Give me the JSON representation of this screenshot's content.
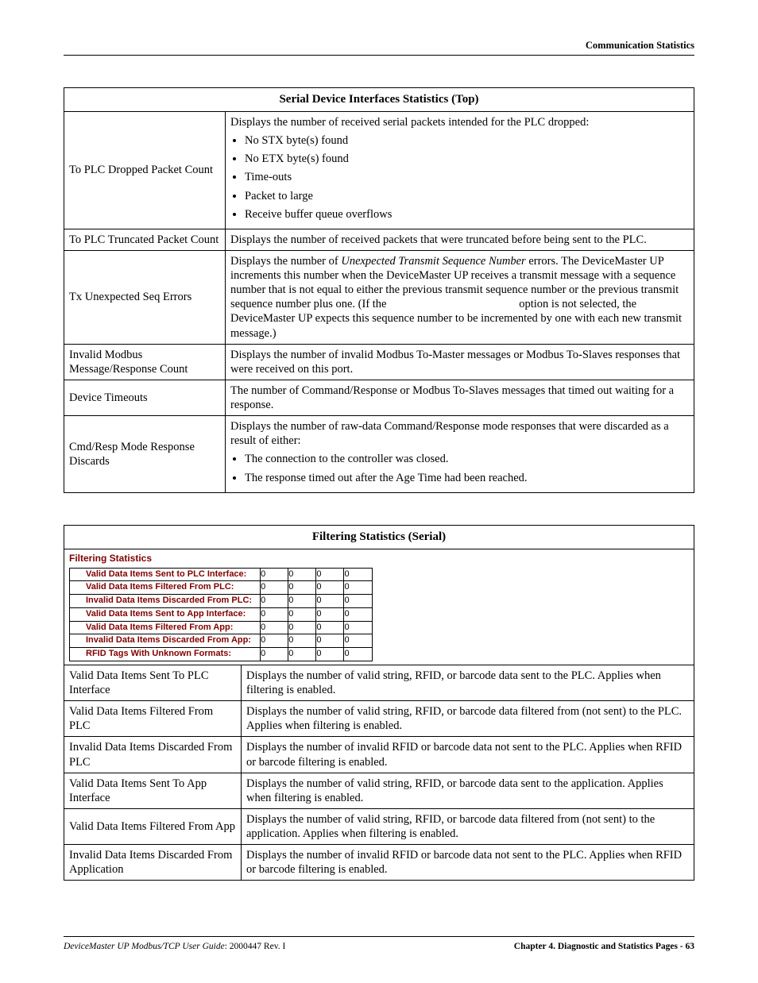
{
  "header": {
    "section": "Communication Statistics"
  },
  "table1": {
    "title": "Serial Device Interfaces Statistics (Top)",
    "rows": {
      "r1": {
        "label": "To PLC Dropped Packet Count",
        "intro": "Displays the number of received serial packets intended for the PLC dropped:",
        "b1": "No STX byte(s) found",
        "b2": "No ETX byte(s) found",
        "b3": "Time-outs",
        "b4": "Packet to large",
        "b5": "Receive buffer queue overflows"
      },
      "r2": {
        "label": "To PLC Truncated Packet Count",
        "desc": "Displays the number of received packets that were truncated before being sent to the PLC."
      },
      "r3": {
        "label": "Tx Unexpected Seq Errors",
        "p1a": "Displays the number of ",
        "p1b": "Unexpected Transmit Sequence Number",
        "p1c": " errors. The DeviceMaster UP increments this number when the DeviceMaster UP receives a transmit message with a sequence number that is not equal to either the previous transmit sequence number or the previous transmit sequence number plus one. (If the ",
        "p1d": " option is not selected, the DeviceMaster UP expects this sequence number to be incremented by one with each new transmit message.)"
      },
      "r4": {
        "label": "Invalid Modbus Message/Response Count",
        "desc": "Displays the number of invalid Modbus To-Master messages or Modbus To-Slaves responses that were received on this port."
      },
      "r5": {
        "label": "Device Timeouts",
        "desc": "The number of Command/Response or Modbus To-Slaves messages that timed out waiting for a response."
      },
      "r6": {
        "label": "Cmd/Resp Mode Response Discards",
        "intro": "Displays the number of raw-data Command/Response mode responses that were discarded as a result of either:",
        "b1": "The connection to the controller was closed.",
        "b2": "The response timed out after the Age Time had been reached."
      }
    }
  },
  "table2": {
    "title": "Filtering Statistics (Serial)",
    "fig": {
      "heading": "Filtering Statistics",
      "rows": [
        {
          "label": "Valid Data Items Sent to PLC Interface:",
          "vals": [
            "0",
            "0",
            "0",
            "0"
          ]
        },
        {
          "label": "Valid Data Items Filtered From PLC:",
          "vals": [
            "0",
            "0",
            "0",
            "0"
          ]
        },
        {
          "label": "Invalid Data Items Discarded From PLC:",
          "vals": [
            "0",
            "0",
            "0",
            "0"
          ]
        },
        {
          "label": "Valid Data Items Sent to App Interface:",
          "vals": [
            "0",
            "0",
            "0",
            "0"
          ]
        },
        {
          "label": "Valid Data Items Filtered From App:",
          "vals": [
            "0",
            "0",
            "0",
            "0"
          ]
        },
        {
          "label": "Invalid Data Items Discarded From App:",
          "vals": [
            "0",
            "0",
            "0",
            "0"
          ]
        },
        {
          "label": "RFID Tags With Unknown Formats:",
          "vals": [
            "0",
            "0",
            "0",
            "0"
          ]
        }
      ]
    },
    "rows": {
      "r1": {
        "label": "Valid Data Items Sent To PLC Interface",
        "desc": "Displays the number of valid string, RFID, or barcode data sent to the PLC. Applies when filtering is enabled."
      },
      "r2": {
        "label": "Valid Data Items Filtered From PLC",
        "desc": "Displays the number of valid string, RFID, or barcode data filtered from (not sent) to the PLC. Applies when filtering is enabled."
      },
      "r3": {
        "label": "Invalid Data Items Discarded From PLC",
        "desc": "Displays the number of invalid RFID or barcode data not sent to the PLC. Applies when RFID or barcode filtering is enabled."
      },
      "r4": {
        "label": "Valid Data Items Sent To App Interface",
        "desc": "Displays the number of valid string, RFID, or barcode data sent to the application. Applies when filtering is enabled."
      },
      "r5": {
        "label": "Valid Data Items Filtered From App",
        "desc": "Displays the number of valid string, RFID, or barcode data filtered from (not sent) to the application. Applies when filtering is enabled."
      },
      "r6": {
        "label": "Invalid Data Items Discarded From Application",
        "desc": "Displays the number of invalid RFID or barcode data not sent to the PLC. Applies when RFID or barcode filtering is enabled."
      }
    }
  },
  "footer": {
    "left_italic": "DeviceMaster UP Modbus/TCP User Guide",
    "left_rev": ": 2000447 Rev. I",
    "right": "Chapter 4. Diagnostic and Statistics Pages - 63"
  }
}
